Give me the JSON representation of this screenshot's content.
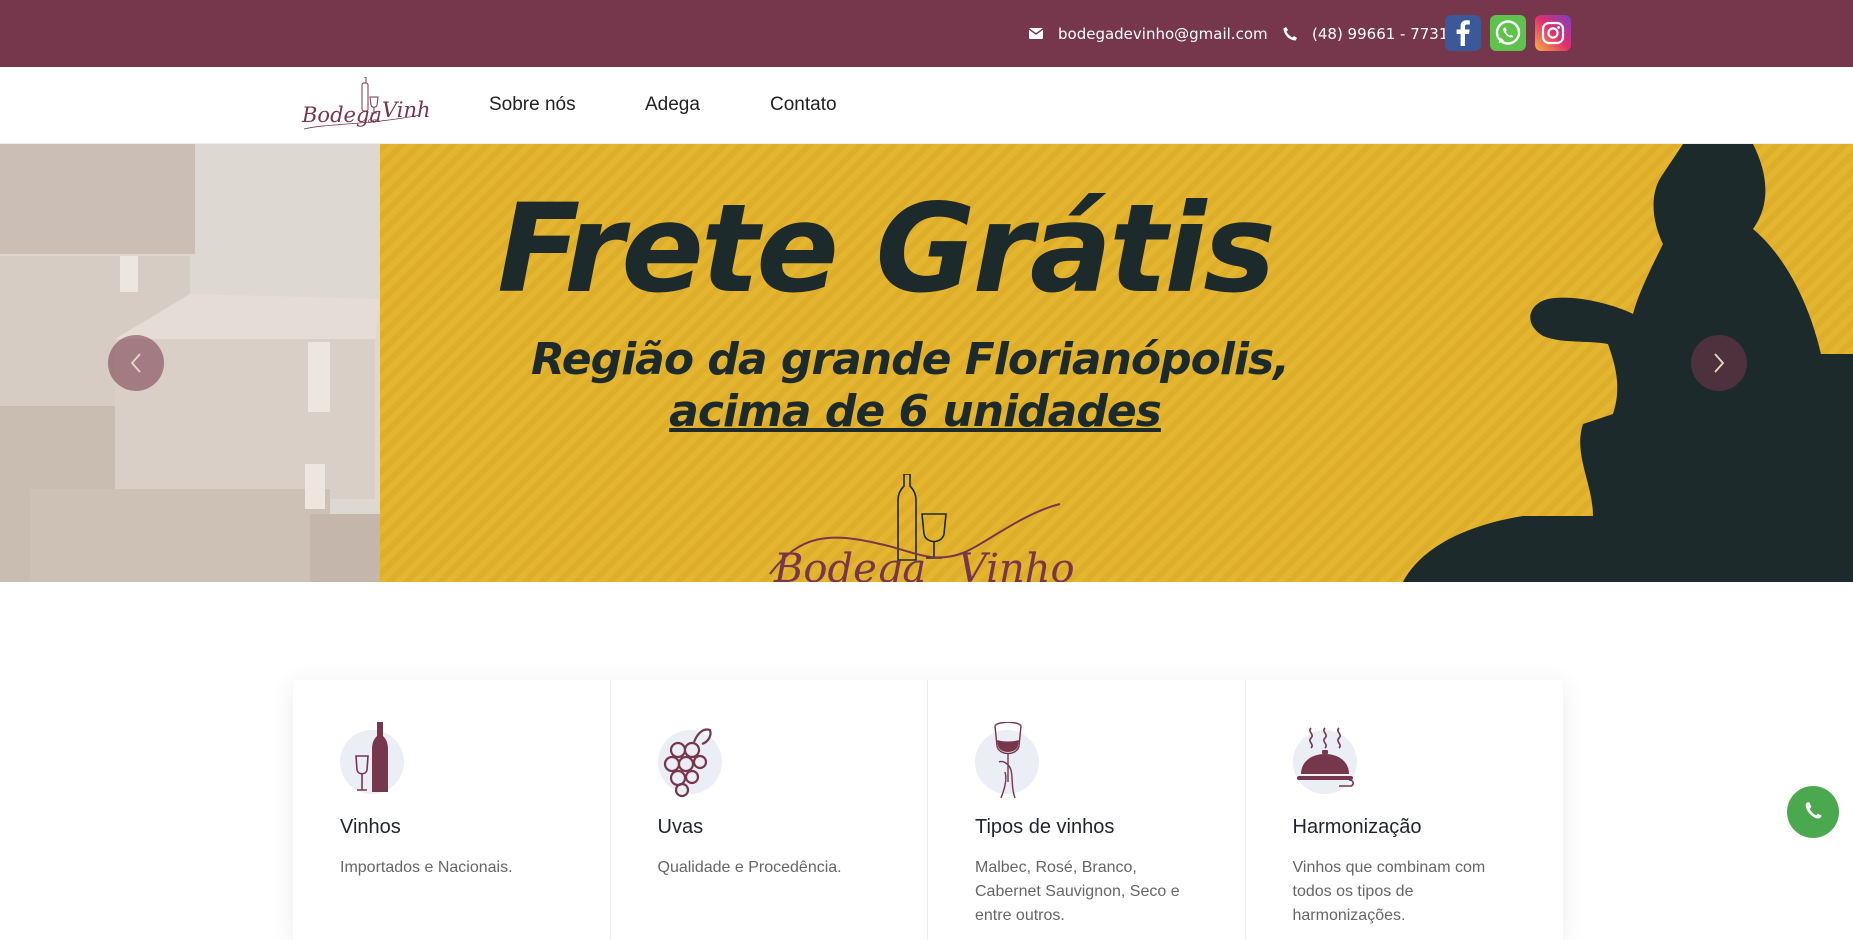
{
  "topbar": {
    "email": "bodegadevinho@gmail.com",
    "phone": "(48) 99661 - 7731",
    "icons": {
      "email": "envelope-icon",
      "phone": "phone-icon"
    },
    "social": [
      "facebook-icon",
      "whatsapp-icon",
      "instagram-icon"
    ],
    "colors": {
      "background": "#76364b",
      "text": "#ffffff"
    }
  },
  "nav": {
    "logo_text": "Bodega de Vinho",
    "items": [
      {
        "label": "Sobre nós"
      },
      {
        "label": "Adega"
      },
      {
        "label": "Contato"
      }
    ]
  },
  "hero": {
    "title": "Frete Grátis",
    "subtitle_line1": "Região da grande Florianópolis,",
    "subtitle_line2": "acima de 6 unidades",
    "logo_text": "Bodega de Vinho",
    "prev_icon": "chevron-left-icon",
    "next_icon": "chevron-right-icon",
    "colors": {
      "background": "#e4b52f",
      "text": "#1c2a2b",
      "brand": "#76364b"
    }
  },
  "features": [
    {
      "icon": "wine-bottle-glass-icon",
      "title": "Vinhos",
      "description": "Importados e Nacionais."
    },
    {
      "icon": "grapes-icon",
      "title": "Uvas",
      "description": "Qualidade e Procedência."
    },
    {
      "icon": "wine-tasting-icon",
      "title": "Tipos de vinhos",
      "description": "Malbec, Rosé, Branco, Cabernet Sauvignon, Seco e entre outros."
    },
    {
      "icon": "cloche-icon",
      "title": "Harmonização",
      "description": "Vinhos que combinam com todos os tipos de harmonizações."
    }
  ],
  "floating": {
    "icon": "whatsapp-icon",
    "color": "#4aa94f"
  }
}
